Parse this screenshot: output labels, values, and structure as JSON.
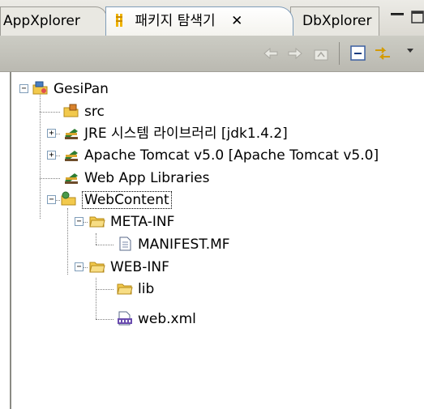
{
  "tabs": {
    "appxplorer": "AppXplorer",
    "active": "패키지 탐색기",
    "dbxplorer": "DbXplorer"
  },
  "tree": {
    "root": "GesiPan",
    "src": "src",
    "jre": "JRE 시스템 라이브러리 [jdk1.4.2]",
    "tomcat": "Apache Tomcat v5.0 [Apache Tomcat v5.0]",
    "webapp": "Web App Libraries",
    "webcontent": "WebContent",
    "metainf": "META-INF",
    "manifest": "MANIFEST.MF",
    "webinf": "WEB-INF",
    "lib": "lib",
    "webxml": "web.xml"
  },
  "toggles": {
    "collapse": "−",
    "expand": "+"
  },
  "colors": {
    "folder": "#f2c94c",
    "project": "#4a7fc1",
    "library": "#2e7d32",
    "active_tab_icon": "#f0b400"
  }
}
